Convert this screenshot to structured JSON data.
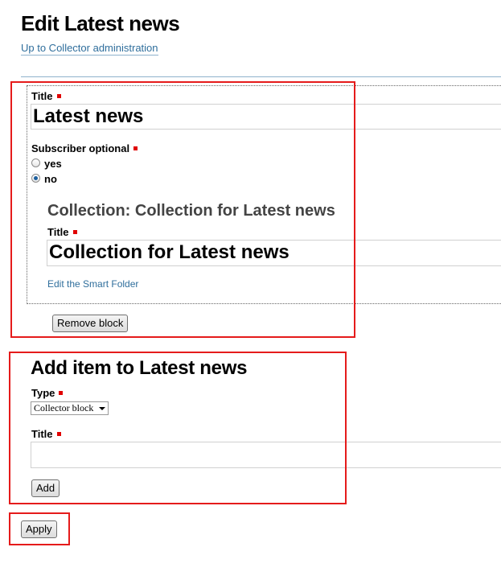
{
  "page": {
    "title": "Edit Latest news",
    "up_link": "Up to Collector administration"
  },
  "block": {
    "title_label": "Title",
    "title_value": "Latest news",
    "subscriber_label": "Subscriber optional",
    "options": [
      {
        "label": "yes",
        "checked": false
      },
      {
        "label": "no",
        "checked": true
      }
    ],
    "collection": {
      "heading": "Collection: Collection for Latest news",
      "title_label": "Title",
      "title_value": "Collection for Latest news",
      "edit_link": "Edit the Smart Folder"
    },
    "remove_button": "Remove block"
  },
  "add_item": {
    "heading": "Add item to Latest news",
    "type_label": "Type",
    "type_selected": "Collector block",
    "title_label": "Title",
    "title_value": "",
    "add_button": "Add"
  },
  "apply_button": "Apply",
  "colors": {
    "annotation_red": "#e51b1b",
    "link_blue": "#2f6e9c",
    "required_red": "#e00000"
  }
}
